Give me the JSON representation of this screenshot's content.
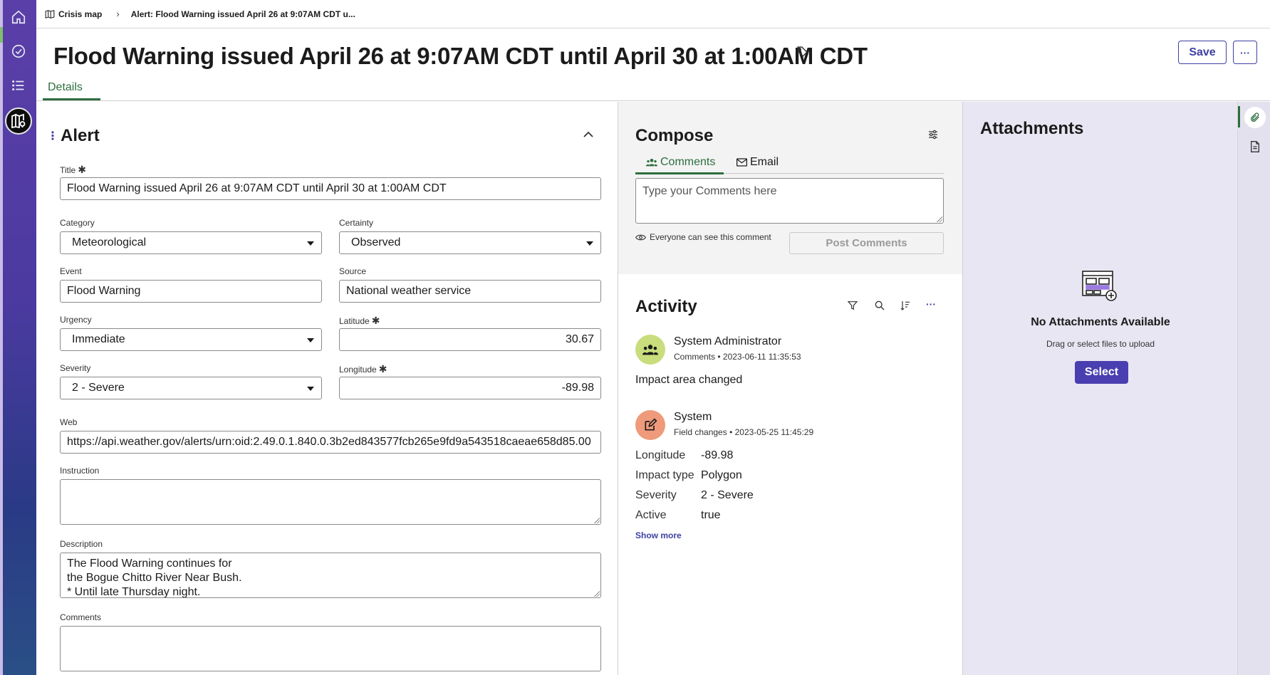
{
  "breadcrumb": {
    "home": "Crisis map",
    "current": "Alert: Flood Warning issued April 26 at 9:07AM CDT u..."
  },
  "header": {
    "title": "Flood Warning issued April 26 at 9:07AM CDT until April 30 at 1:00AM CDT",
    "save_label": "Save",
    "more_label": "···",
    "tab_details": "Details"
  },
  "form": {
    "section_title": "Alert",
    "title_label": "Title",
    "title_value": "Flood Warning issued April 26 at 9:07AM CDT until April 30 at 1:00AM CDT",
    "category_label": "Category",
    "category_value": "Meteorological",
    "certainty_label": "Certainty",
    "certainty_value": "Observed",
    "event_label": "Event",
    "event_value": "Flood Warning",
    "source_label": "Source",
    "source_value": "National weather service",
    "urgency_label": "Urgency",
    "urgency_value": "Immediate",
    "latitude_label": "Latitude",
    "latitude_value": "30.67",
    "severity_label": "Severity",
    "severity_value": "2 - Severe",
    "longitude_label": "Longitude",
    "longitude_value": "-89.98",
    "web_label": "Web",
    "web_value": "https://api.weather.gov/alerts/urn:oid:2.49.0.1.840.0.3b2ed843577fcb265e9fd9a543518caeae658d85.00",
    "instruction_label": "Instruction",
    "instruction_value": "",
    "description_label": "Description",
    "description_lines": [
      "The Flood Warning continues for",
      "the Bogue Chitto River Near Bush.",
      "* Until late Thursday night."
    ],
    "comments_label": "Comments",
    "comments_value": "",
    "required_mark": "✱"
  },
  "compose": {
    "title": "Compose",
    "tab_comments": "Comments",
    "tab_email": "Email",
    "placeholder": "Type your Comments here",
    "visibility": "Everyone can see this comment",
    "post_label": "Post Comments"
  },
  "activity": {
    "title": "Activity",
    "entries": [
      {
        "author": "System Administrator",
        "type": "Comments",
        "timestamp": "2023-06-11 11:35:53",
        "text": "Impact area changed"
      },
      {
        "author": "System",
        "type": "Field changes",
        "timestamp": "2023-05-25 11:45:29",
        "changes": [
          {
            "key": "Longitude",
            "value": "-89.98"
          },
          {
            "key": "Impact type",
            "value": "Polygon"
          },
          {
            "key": "Severity",
            "value": "2 - Severe"
          },
          {
            "key": "Active",
            "value": "true"
          }
        ]
      }
    ],
    "show_more": "Show more",
    "meta_sep": "•"
  },
  "attachments": {
    "title": "Attachments",
    "empty_title": "No Attachments Available",
    "hint": "Drag or select files to upload",
    "select_label": "Select"
  },
  "colors": {
    "accent": "#3f3fa6",
    "tab_active": "#2e6e3e",
    "primary_button": "#4a3fb0",
    "avatar_admin": "#c9dd7c",
    "avatar_system": "#ef9a7a"
  }
}
